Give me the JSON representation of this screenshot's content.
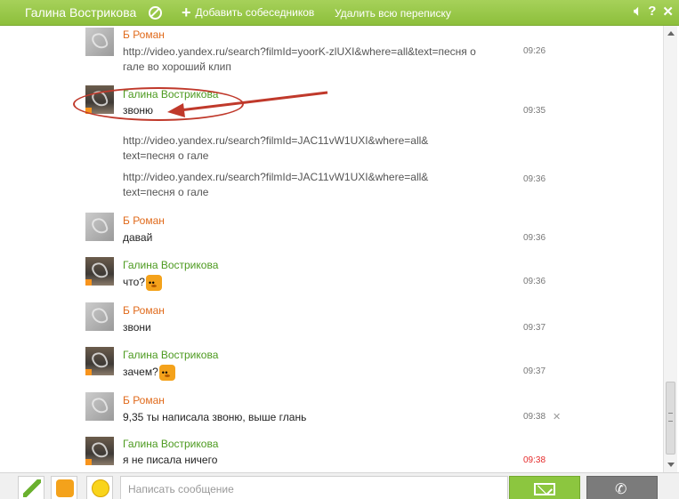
{
  "header": {
    "title": "Галина Вострикова",
    "add_label": "Добавить собеседников",
    "delete_label": "Удалить всю переписку",
    "icons": [
      "block-icon",
      "plus-icon",
      "mute-icon",
      "help-icon",
      "close-icon"
    ]
  },
  "messages": [
    {
      "author": "Б Роман",
      "kind": "roman",
      "lines": [
        "http://video.yandex.ru/search?filmId=yoorK-zlUXI&where=all&text=песня о",
        "гале во хороший клип"
      ],
      "time": "09:26"
    },
    {
      "author": "Галина Вострикова",
      "kind": "galina",
      "lines": [
        "звоню"
      ],
      "time": "09:35"
    },
    {
      "author": "",
      "kind": "cont",
      "lines": [
        "http://video.yandex.ru/search?filmId=JAC11vW1UXI&where=all&",
        "text=песня о гале"
      ],
      "time": ""
    },
    {
      "author": "",
      "kind": "cont",
      "lines": [
        "http://video.yandex.ru/search?filmId=JAC11vW1UXI&where=all&",
        "text=песня о гале"
      ],
      "time": "09:36"
    },
    {
      "author": "Б Роман",
      "kind": "roman",
      "lines": [
        "давай"
      ],
      "time": "09:36"
    },
    {
      "author": "Галина Вострикова",
      "kind": "galina",
      "lines": [
        "что?"
      ],
      "time": "09:36",
      "smile": true
    },
    {
      "author": "Б Роман",
      "kind": "roman",
      "lines": [
        "звони"
      ],
      "time": "09:37"
    },
    {
      "author": "Галина Вострикова",
      "kind": "galina",
      "lines": [
        "зачем?"
      ],
      "time": "09:37",
      "smile": true
    },
    {
      "author": "Б Роман",
      "kind": "roman",
      "lines": [
        "9,35 ты написала звоню, выше глань"
      ],
      "time": "09:38",
      "close": "✕"
    },
    {
      "author": "Галина Вострикова",
      "kind": "galina",
      "lines": [
        "я не писала ничего"
      ],
      "time": "09:38",
      "time_red": true
    }
  ],
  "footer": {
    "input_placeholder": "Написать сообщение"
  },
  "colors": {
    "header_green": "#8dbf3b",
    "roman_name": "#e06a1b",
    "galina_name": "#4c9a1f",
    "annotation_red": "#c0392b"
  }
}
